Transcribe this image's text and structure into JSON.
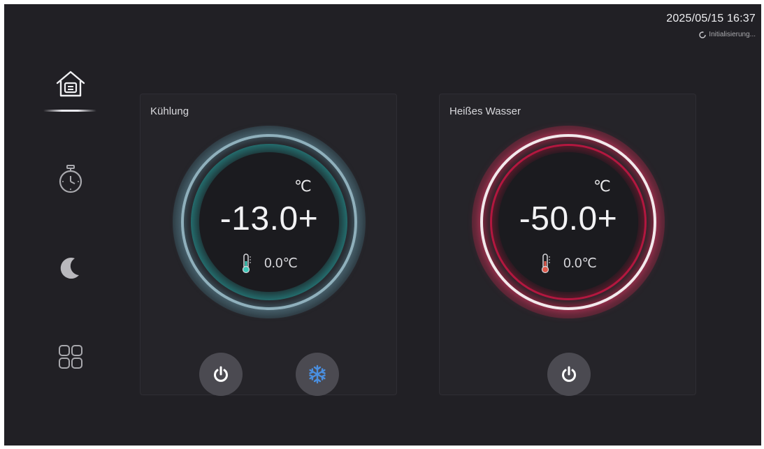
{
  "status": {
    "datetime": "2025/05/15 16:37",
    "init_text": "Initialisierung..."
  },
  "sidebar": {
    "items": [
      {
        "icon": "home-icon",
        "active": true
      },
      {
        "icon": "timer-icon",
        "active": false
      },
      {
        "icon": "moon-icon",
        "active": false
      },
      {
        "icon": "grid-icon",
        "active": false
      }
    ]
  },
  "cards": {
    "cooling": {
      "title": "Kühlung",
      "unit": "℃",
      "setpoint": "-13.0+",
      "current": "0.0℃",
      "accent": "#2aa8a6"
    },
    "hotwater": {
      "title": "Heißes Wasser",
      "unit": "℃",
      "setpoint": "-50.0+",
      "current": "0.0℃",
      "accent": "#e0224f"
    }
  },
  "colors": {
    "background": "#212025",
    "card": "#252429",
    "button": "#4b4a51",
    "snowflake": "#4a8fe0",
    "thermo_cool": "#3fc7b8",
    "thermo_hot": "#e05a4c"
  }
}
